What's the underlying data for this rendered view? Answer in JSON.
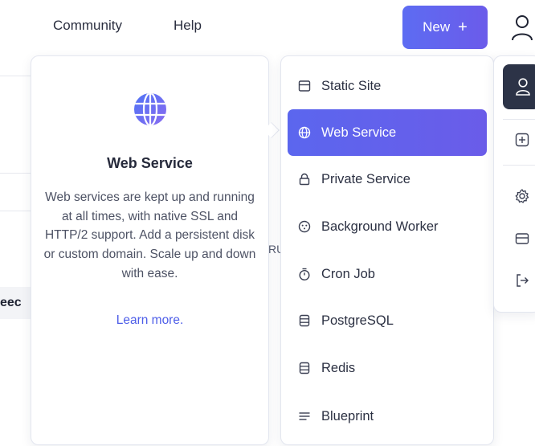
{
  "topbar": {
    "community_label": "Community",
    "help_label": "Help",
    "new_button_label": "New",
    "new_button_plus": "+"
  },
  "background": {
    "fragment_left": "eec",
    "fragment_mid": "RU"
  },
  "info_card": {
    "icon": "globe-icon",
    "title": "Web Service",
    "description": "Web services are kept up and running at all times, with native SSL and HTTP/2 support. Add a persistent disk or custom domain. Scale up and down with ease.",
    "learn_more": "Learn more."
  },
  "menu": {
    "items": [
      {
        "label": "Static Site",
        "icon": "static-site-icon"
      },
      {
        "label": "Web Service",
        "icon": "globe-icon",
        "active": true
      },
      {
        "label": "Private Service",
        "icon": "lock-icon"
      },
      {
        "label": "Background Worker",
        "icon": "worker-icon"
      },
      {
        "label": "Cron Job",
        "icon": "stopwatch-icon"
      },
      {
        "label": "PostgreSQL",
        "icon": "database-icon"
      },
      {
        "label": "Redis",
        "icon": "database-icon"
      },
      {
        "label": "Blueprint",
        "icon": "lines-icon"
      }
    ]
  },
  "colors": {
    "accent": "#5b66ee",
    "accent_end": "#6a5ce9",
    "link": "#4e5ee8",
    "rail_active": "#2c3347"
  }
}
